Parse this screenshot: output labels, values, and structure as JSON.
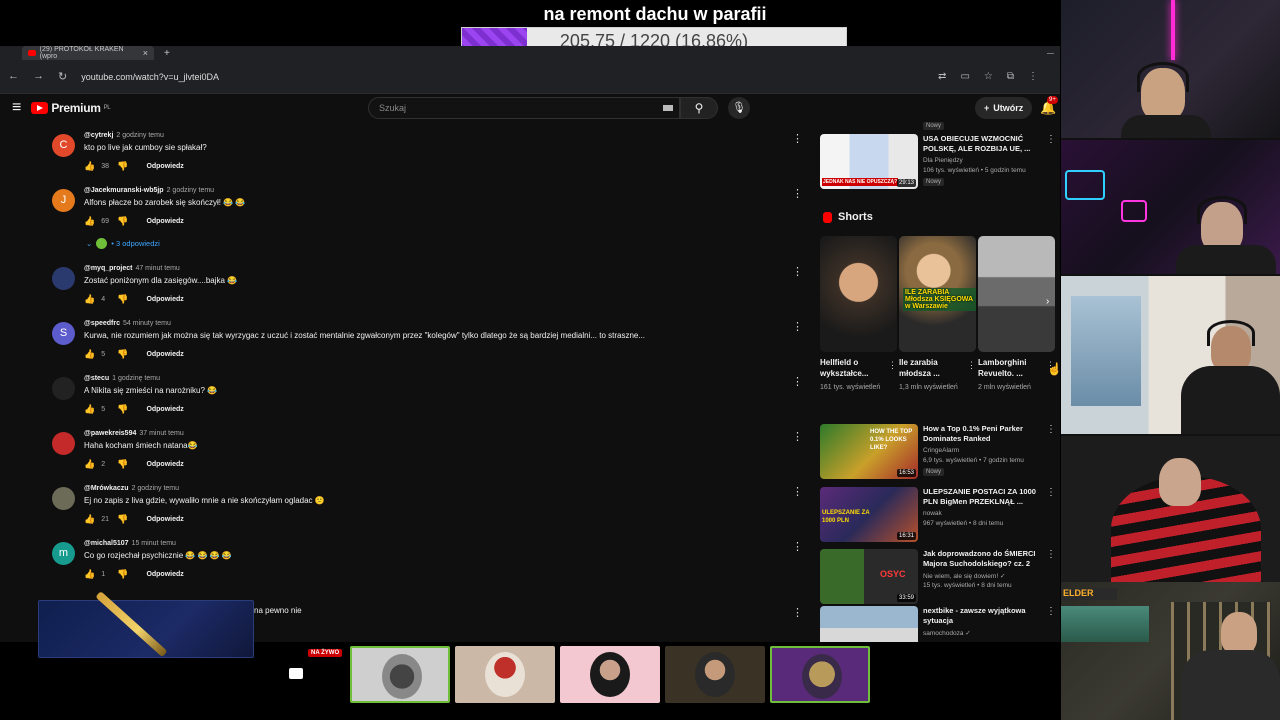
{
  "stream": {
    "donation_goal_title": "na remont dachu w parafii",
    "donation_progress_text": "205.75 / 1220 (16.86%)",
    "donation_progress_fraction": 0.1686,
    "bar_color": "#8a3ce0"
  },
  "browser": {
    "tab_title": "(29) PROTOKÓŁ KRAKEN (wpro",
    "tab_close": "×",
    "new_tab": "+",
    "url": "youtube.com/watch?v=u_jlvtei0DA"
  },
  "youtube": {
    "logo_text": "Premium",
    "logo_region": "PL",
    "search_placeholder": "Szukaj",
    "create_label": "Utwórz",
    "notification_count": "9+",
    "brand_color": "#ff0000"
  },
  "comments": [
    {
      "author": "@cytrekj",
      "time": "2 godziny temu",
      "text": "kto po live jak cumboy sie spłakał?",
      "likes": "38",
      "reply_label": "Odpowiedz",
      "avatar_letter": "C",
      "avatar_color": "#e1492a"
    },
    {
      "author": "@Jacekmuranski-wb5jp",
      "time": "2 godziny temu",
      "text": "Alfons płacze bo zarobek się skończył! 😂 😂",
      "likes": "69",
      "reply_label": "Odpowiedz",
      "avatar_letter": "J",
      "avatar_color": "#e47a1b"
    },
    {
      "author": "@myq_project",
      "time": "47 minut temu",
      "text": "Zostać poniżonym dla zasięgów....bajka 😂",
      "likes": "4",
      "reply_label": "Odpowiedz",
      "avatar_letter": "",
      "avatar_color": "#2b3a6e"
    },
    {
      "author": "@speedfrc",
      "time": "54 minuty temu",
      "text": "Kurwa, nie rozumiem jak można się tak wyrzygac z uczuć i zostać mentalnie zgwałconym przez \"kolegów\" tylko dlatego że są bardziej medialni... to straszne...",
      "likes": "5",
      "reply_label": "Odpowiedz",
      "avatar_letter": "S",
      "avatar_color": "#5c5ccc"
    },
    {
      "author": "@stecu",
      "time": "1 godzinę temu",
      "text": "A Nikita się zmieści na narożniku? 😂",
      "likes": "5",
      "reply_label": "Odpowiedz",
      "avatar_letter": "",
      "avatar_color": "#222222"
    },
    {
      "author": "@pawekreis594",
      "time": "37 minut temu",
      "text": "Haha kocham śmiech natana😂",
      "likes": "2",
      "reply_label": "Odpowiedz",
      "avatar_letter": "",
      "avatar_color": "#c42a2a"
    },
    {
      "author": "@Mrówkaczu",
      "time": "2 godziny temu",
      "text": "Ej no zapis z liva gdzie, wywaliło mnie a nie skończyłam ogladac 😕",
      "likes": "21",
      "reply_label": "Odpowiedz",
      "avatar_letter": "",
      "avatar_color": "#6b6b58"
    },
    {
      "author": "@michal5107",
      "time": "15 minut temu",
      "text": "Co go rozjechał psychicznie 😂 😂 😂 😂",
      "likes": "1",
      "reply_label": "Odpowiedz",
      "avatar_letter": "m",
      "avatar_color": "#169b8e"
    }
  ],
  "partial_comment_text": "na pewno nie",
  "replies_toggle": "• 3 odpowiedzi",
  "sidebar": {
    "top_badge": "Nowy",
    "videos_top": [
      {
        "title": "USA OBIECUJE WZMOCNIĆ POLSKĘ, ALE ROZBIJA UE, ...",
        "channel": "Dla Pieniędzy",
        "stats": "106 tys. wyświetleń • 5 godzin temu",
        "badge": "Nowy",
        "duration": "29:13",
        "thumb_text": "JEDNAK NAS NIE OPUSZCZĄ?"
      }
    ],
    "shorts_title": "Shorts",
    "shorts": [
      {
        "title": "Hellfield o wykształce...",
        "views": "161 tys. wyświetleń",
        "caption": ""
      },
      {
        "title": "Ile zarabia młodsza ...",
        "views": "1,3 mln wyświetleń",
        "caption": "ILE ZARABIA Młodsza KSIĘGOWA w Warszawie"
      },
      {
        "title": "Lamborghini Revuelto. ...",
        "views": "2 mln wyświetleń",
        "caption": ""
      }
    ],
    "videos_bottom": [
      {
        "title": "How a Top 0.1% Peni Parker Dominates Ranked",
        "channel": "CringeAlarm",
        "stats": "6,9 tys. wyświetleń • 7 godzin temu",
        "badge": "Nowy",
        "duration": "16:53",
        "thumb_text": "HOW THE TOP 0.1% LOOKS LIKE?"
      },
      {
        "title": "ULEPSZANIE POSTACI ZA 1000 PLN BigMen PRZEKLNĄŁ ...",
        "channel": "nowak",
        "stats": "967 wyświetleń • 8 dni temu",
        "badge": "",
        "duration": "16:31",
        "thumb_text": "ULEPSZANIE ZA 1000 PLN"
      },
      {
        "title": "Jak doprowadzono do ŚMIERCI Majora Suchodolskiego? cz. 2",
        "channel": "Nie wiem, ale się dowiem! ✓",
        "stats": "15 tys. wyświetleń • 8 dni temu",
        "badge": "",
        "duration": "33:59",
        "thumb_text": "OSYC"
      },
      {
        "title": "nextbike - zawsze wyjątkowa sytuacja",
        "channel": "samochodoza ✓",
        "stats": "",
        "badge": "",
        "duration": "",
        "thumb_text": ""
      }
    ]
  },
  "strip": {
    "live_label": "NA ŻYWO"
  }
}
